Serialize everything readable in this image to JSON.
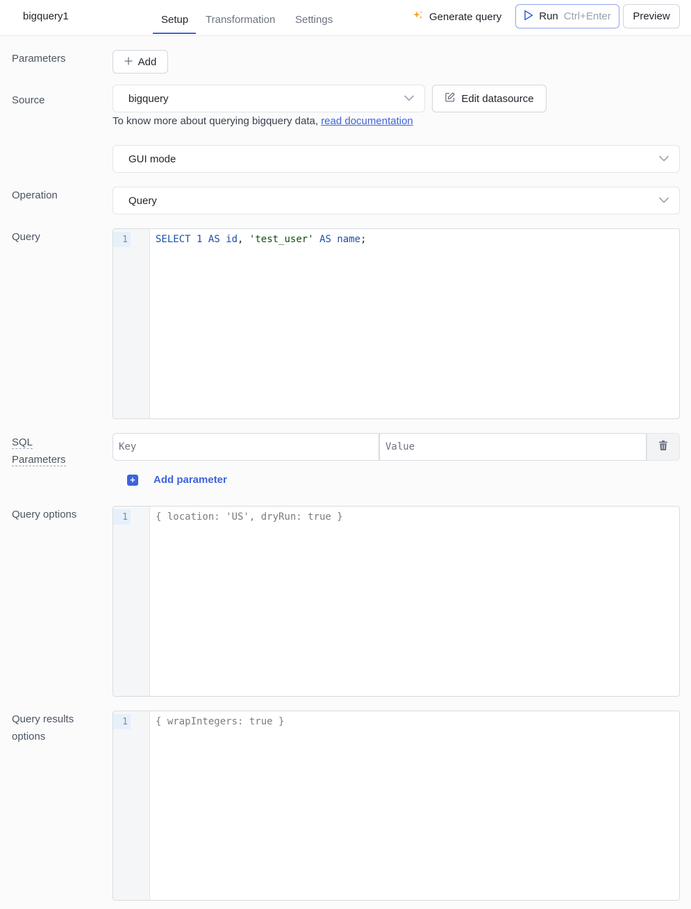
{
  "header": {
    "query_name": "bigquery1",
    "tabs": [
      {
        "label": "Setup",
        "active": true
      },
      {
        "label": "Transformation",
        "active": false
      },
      {
        "label": "Settings",
        "active": false
      }
    ],
    "generate_query_label": "Generate query",
    "run_label": "Run",
    "run_shortcut": "Ctrl+Enter",
    "preview_label": "Preview"
  },
  "labels": {
    "parameters": "Parameters",
    "source": "Source",
    "operation": "Operation",
    "query": "Query",
    "sql_parameters_line1": "SQL",
    "sql_parameters_line2": "Parameters",
    "query_options": "Query options",
    "query_results_line1": "Query results",
    "query_results_line2": "options"
  },
  "parameters": {
    "add_label": "Add"
  },
  "source": {
    "selected": "bigquery",
    "edit_label": "Edit datasource",
    "help_text": "To know more about querying bigquery data, ",
    "help_link": "read documentation"
  },
  "mode": {
    "selected": "GUI mode"
  },
  "operation": {
    "selected": "Query"
  },
  "query_editor": {
    "line_number": "1",
    "tokens": {
      "t1": "SELECT",
      "t2": " ",
      "t3": "1",
      "t4": " ",
      "t5": "AS",
      "t6": " ",
      "t7": "id",
      "t8": ", ",
      "t9": "'test_user'",
      "t10": " ",
      "t11": "AS",
      "t12": " ",
      "t13": "name",
      "t14": ";"
    }
  },
  "sql_parameters": {
    "key_placeholder": "Key",
    "value_placeholder": "Value",
    "add_label": "Add parameter"
  },
  "query_options_editor": {
    "line_number": "1",
    "code": "{ location: 'US', dryRun: true }"
  },
  "query_results_editor": {
    "line_number": "1",
    "code": "{ wrapIntegers: true }"
  },
  "colors": {
    "accent": "#3e63dd",
    "sparkle": "#f5a524"
  }
}
